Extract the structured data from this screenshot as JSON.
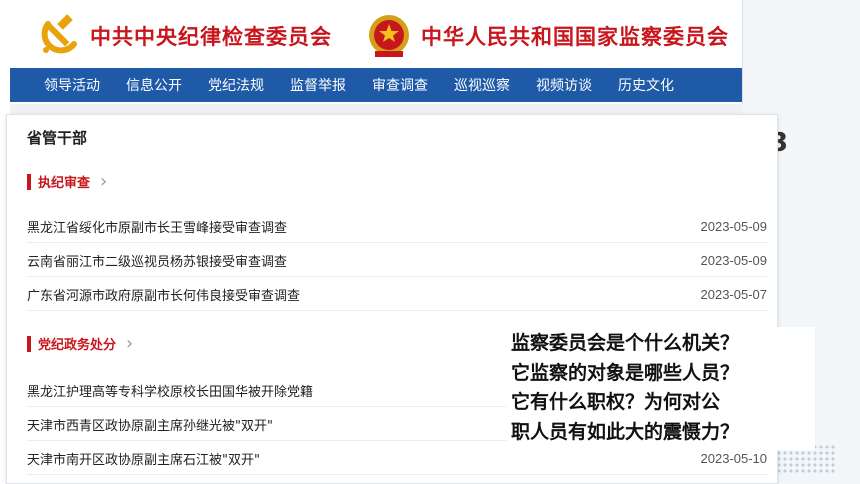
{
  "header": {
    "org_left": "中共中央纪律检查委员会",
    "org_right": "中华人民共和国国家监察委员会",
    "nav": [
      "领导活动",
      "信息公开",
      "党纪法规",
      "监督举报",
      "审查调查",
      "巡视巡察",
      "视频访谈",
      "历史文化"
    ]
  },
  "card": {
    "title": "省管干部",
    "sections": [
      {
        "label": "执纪审查",
        "rows": [
          {
            "title": "黑龙江省绥化市原副市长王雪峰接受审查调查",
            "date": "2023-05-09"
          },
          {
            "title": "云南省丽江市二级巡视员杨苏银接受审查调查",
            "date": "2023-05-09"
          },
          {
            "title": "广东省河源市政府原副市长何伟良接受审查调查",
            "date": "2023-05-07"
          }
        ]
      },
      {
        "label": "党纪政务处分",
        "rows": [
          {
            "title": "黑龙江护理高等专科学校原校长田国华被开除党籍",
            "date": ""
          },
          {
            "title": "天津市西青区政协原副主席孙继光被\"双开\"",
            "date": ""
          },
          {
            "title": "天津市南开区政协原副主席石江被\"双开\"",
            "date": "2023-05-10"
          }
        ]
      }
    ]
  },
  "background": {
    "edge_text": "3"
  },
  "overlay": {
    "lines": [
      "监察委员会是个什么机关？",
      "它监察的对象是哪些人员？",
      "它有什么职权？为何对公",
      "职人员有如此大的震慑力？"
    ]
  },
  "colors": {
    "brand_red": "#c8161d",
    "nav_blue": "#1e5aa8"
  },
  "icons": {
    "left": "hammer-sickle-icon",
    "right": "national-emblem-icon",
    "chevron": "chevron-right-icon"
  }
}
